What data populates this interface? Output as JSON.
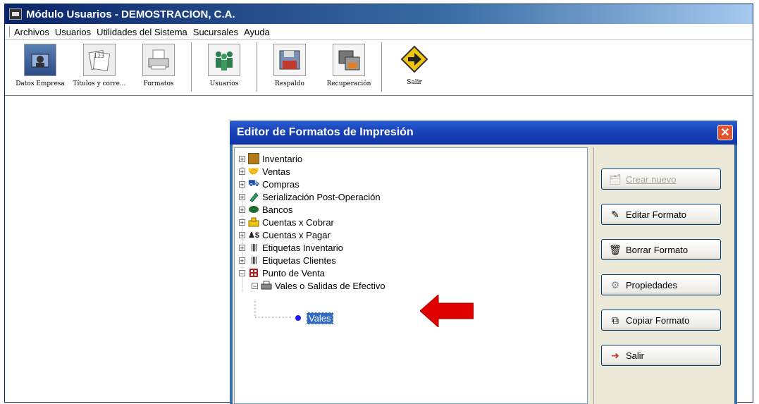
{
  "window": {
    "title": "Módulo Usuarios - DEMOSTRACION, C.A."
  },
  "menu": [
    "Archivos",
    "Usuarios",
    "Utilidades del Sistema",
    "Sucursales",
    "Ayuda"
  ],
  "toolbar": [
    {
      "label": "Datos Empresa",
      "icon": "building-icon"
    },
    {
      "label": "Títulos y corre...",
      "icon": "cards-icon"
    },
    {
      "label": "Formatos",
      "icon": "printer-icon"
    },
    {
      "label": "Usuarios",
      "icon": "users-icon"
    },
    {
      "label": "Respaldo",
      "icon": "floppy-icon"
    },
    {
      "label": "Recuperación",
      "icon": "restore-icon"
    },
    {
      "label": "Salir",
      "icon": "exit-sign-icon"
    }
  ],
  "dialog": {
    "title": "Editor de Formatos de Impresión",
    "tree": [
      {
        "label": "Inventario",
        "icon": "inventory-icon",
        "expander": "+"
      },
      {
        "label": "Ventas",
        "icon": "handshake-icon",
        "expander": "+"
      },
      {
        "label": "Compras",
        "icon": "truck-icon",
        "expander": "+"
      },
      {
        "label": "Serialización Post-Operación",
        "icon": "tag-icon",
        "expander": "+"
      },
      {
        "label": "Bancos",
        "icon": "money-icon",
        "expander": "+"
      },
      {
        "label": "Cuentas x Cobrar",
        "icon": "cashbox-icon",
        "expander": "+"
      },
      {
        "label": "Cuentas x Pagar",
        "icon": "payment-icon",
        "expander": "+"
      },
      {
        "label": "Etiquetas Inventario",
        "icon": "barcode-icon",
        "expander": "+"
      },
      {
        "label": "Etiquetas Clientes",
        "icon": "barcode-icon",
        "expander": "+"
      },
      {
        "label": "Punto de Venta",
        "icon": "pos-icon",
        "expander": "−"
      },
      {
        "label": "Vales o Salidas de Efectivo",
        "icon": "printer-icon",
        "expander": "−"
      },
      {
        "label": "Vales",
        "icon": "bullet-icon",
        "selected": true
      }
    ],
    "buttons": [
      {
        "label": "Crear nuevo",
        "icon": "new-icon",
        "mnemonic": "C",
        "disabled": true
      },
      {
        "label": "Editar Formato",
        "icon": "edit-icon",
        "mnemonic": "E"
      },
      {
        "label": "Borrar Formato",
        "icon": "trash-icon",
        "mnemonic": "B"
      },
      {
        "label": "Propiedades",
        "icon": "gear-icon",
        "mnemonic": "P"
      },
      {
        "label": "Copiar Formato",
        "icon": "copy-icon",
        "mnemonic": "C"
      },
      {
        "label": "Salir",
        "icon": "exit-icon",
        "mnemonic": "S"
      }
    ]
  },
  "colors": {
    "selection": "#316ac5",
    "annotation_arrow": "#e00000",
    "dialog_title": "#1942b8"
  }
}
